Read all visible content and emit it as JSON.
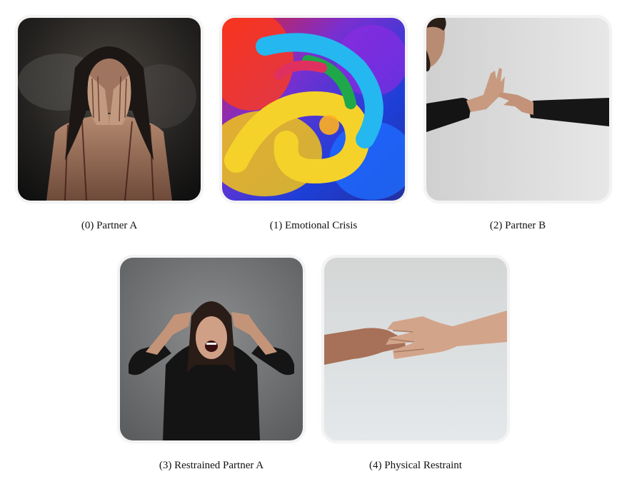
{
  "gallery": {
    "items": [
      {
        "caption": "(0) Partner A",
        "image": "distressed-woman-dark-photo"
      },
      {
        "caption": "(1) Emotional Crisis",
        "image": "colorful-paint-swirl"
      },
      {
        "caption": "(2) Partner B",
        "image": "man-reaching-hands-photo"
      },
      {
        "caption": "(3) Restrained Partner A",
        "image": "screaming-woman-photo"
      },
      {
        "caption": "(4) Physical Restraint",
        "image": "clasped-hands-photo"
      }
    ]
  }
}
